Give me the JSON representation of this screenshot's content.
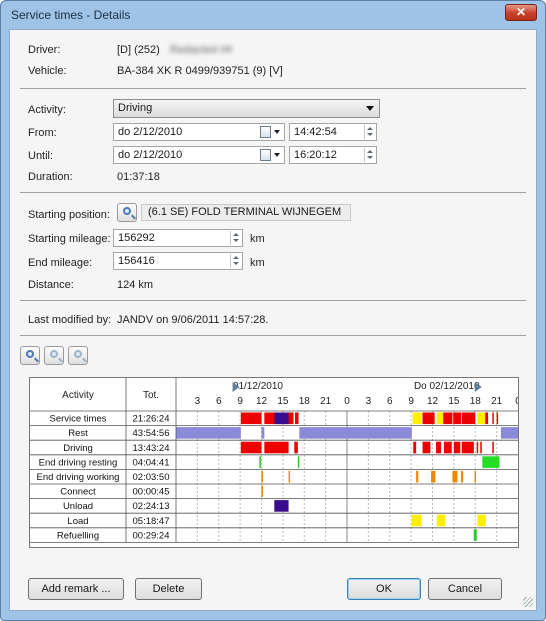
{
  "window": {
    "title": "Service times - Details",
    "close_glyph": "✕"
  },
  "info": {
    "driver_label": "Driver:",
    "driver_value": "[D] (252)",
    "driver_name_redacted": "Redacted ##",
    "vehicle_label": "Vehicle:",
    "vehicle_value": "BA-384 XK R 0499/939751 (9) [V]"
  },
  "activity": {
    "activity_label": "Activity:",
    "activity_value": "Driving",
    "from_label": "From:",
    "from_date": "do  2/12/2010",
    "from_time": "14:42:54",
    "until_label": "Until:",
    "until_date": "do  2/12/2010",
    "until_time": "16:20:12",
    "duration_label": "Duration:",
    "duration_value": "01:37:18"
  },
  "position": {
    "start_pos_label": "Starting position:",
    "start_pos_value": "(6.1 SE) FOLD TERMINAL WIJNEGEM",
    "start_mileage_label": "Starting mileage:",
    "start_mileage_value": "156292",
    "start_mileage_unit": "km",
    "end_mileage_label": "End mileage:",
    "end_mileage_value": "156416",
    "end_mileage_unit": "km",
    "distance_label": "Distance:",
    "distance_value": "124 km"
  },
  "modified": {
    "label": "Last modified by:",
    "value": "JANDV on 9/06/2011 14:57:28."
  },
  "zoom_icons": [
    "zoom-in-icon",
    "zoom-out-icon",
    "zoom-reset-icon"
  ],
  "chart_data": {
    "type": "table",
    "columns": [
      "Activity",
      "Tot."
    ],
    "day_labels": [
      "01/12/2010",
      "Do 02/12/2010"
    ],
    "hour_ticks": [
      "3",
      "6",
      "9",
      "12",
      "15",
      "18",
      "21",
      "0",
      "3",
      "6",
      "9",
      "12",
      "15",
      "18",
      "21",
      "0"
    ],
    "x_range_hours": [
      0,
      48
    ],
    "rows": [
      {
        "activity": "Service times",
        "total": "21:26:24",
        "segments": [
          {
            "s": 9.1,
            "e": 12.0,
            "c": "#ee0000"
          },
          {
            "s": 12.4,
            "e": 16.5,
            "c": "#ee0000"
          },
          {
            "s": 13.8,
            "e": 15.8,
            "c": "#3a0b8c"
          },
          {
            "s": 16.7,
            "e": 17.2,
            "c": "#ee0000"
          },
          {
            "s": 33.2,
            "e": 34.5,
            "c": "#ffee00"
          },
          {
            "s": 34.6,
            "e": 36.3,
            "c": "#ee0000"
          },
          {
            "s": 36.6,
            "e": 37.5,
            "c": "#ffee00"
          },
          {
            "s": 37.5,
            "e": 38.8,
            "c": "#ee0000"
          },
          {
            "s": 38.9,
            "e": 40.0,
            "c": "#ee0000"
          },
          {
            "s": 40.1,
            "e": 42.0,
            "c": "#ee0000"
          },
          {
            "s": 42.3,
            "e": 43.4,
            "c": "#ffee00"
          },
          {
            "s": 43.4,
            "e": 43.8,
            "c": "#ee0000"
          },
          {
            "s": 44.4,
            "e": 44.6,
            "c": "#ee0000"
          },
          {
            "s": 45.0,
            "e": 45.2,
            "c": "#ee0000"
          }
        ]
      },
      {
        "activity": "Rest",
        "total": "43:54:56",
        "segments": [
          {
            "s": 0,
            "e": 9.1,
            "c": "#8a8ad8"
          },
          {
            "s": 12.0,
            "e": 12.4,
            "c": "#8a8ad8"
          },
          {
            "s": 17.3,
            "e": 33.1,
            "c": "#8a8ad8"
          },
          {
            "s": 45.6,
            "e": 48,
            "c": "#8a8ad8"
          }
        ]
      },
      {
        "activity": "Driving",
        "total": "13:43:24",
        "segments": [
          {
            "s": 9.1,
            "e": 12.0,
            "c": "#ee0000"
          },
          {
            "s": 12.4,
            "e": 15.8,
            "c": "#ee0000"
          },
          {
            "s": 16.6,
            "e": 17.1,
            "c": "#ee0000"
          },
          {
            "s": 33.3,
            "e": 33.7,
            "c": "#ee0000"
          },
          {
            "s": 34.6,
            "e": 35.7,
            "c": "#ee0000"
          },
          {
            "s": 36.5,
            "e": 37.2,
            "c": "#ee0000"
          },
          {
            "s": 37.6,
            "e": 38.7,
            "c": "#ee0000"
          },
          {
            "s": 39.0,
            "e": 39.9,
            "c": "#ee0000"
          },
          {
            "s": 40.1,
            "e": 41.8,
            "c": "#ee0000"
          },
          {
            "s": 42.2,
            "e": 42.4,
            "c": "#ee0000"
          },
          {
            "s": 42.7,
            "e": 42.9,
            "c": "#ee0000"
          },
          {
            "s": 44.4,
            "e": 44.6,
            "c": "#ee0000"
          }
        ]
      },
      {
        "activity": "End driving resting",
        "total": "04:04:41",
        "segments": [
          {
            "s": 11.7,
            "e": 11.9,
            "c": "#22cc22"
          },
          {
            "s": 17.1,
            "e": 17.3,
            "c": "#22cc22"
          },
          {
            "s": 43.0,
            "e": 45.4,
            "c": "#22dd22"
          }
        ]
      },
      {
        "activity": "End driving working",
        "total": "02:03:50",
        "segments": [
          {
            "s": 12.0,
            "e": 12.2,
            "c": "#ee8800"
          },
          {
            "s": 15.8,
            "e": 16.0,
            "c": "#ee8800"
          },
          {
            "s": 33.7,
            "e": 34.0,
            "c": "#ee8800"
          },
          {
            "s": 35.8,
            "e": 36.4,
            "c": "#ee8800"
          },
          {
            "s": 38.8,
            "e": 39.5,
            "c": "#ee8800"
          },
          {
            "s": 40.0,
            "e": 40.3,
            "c": "#ee8800"
          },
          {
            "s": 41.9,
            "e": 42.1,
            "c": "#ee8800"
          }
        ]
      },
      {
        "activity": "Connect",
        "total": "00:00:45",
        "segments": [
          {
            "s": 12.0,
            "e": 12.15,
            "c": "#ee8800"
          }
        ]
      },
      {
        "activity": "Unload",
        "total": "02:24:13",
        "segments": [
          {
            "s": 13.8,
            "e": 15.8,
            "c": "#3a0b8c"
          }
        ]
      },
      {
        "activity": "Load",
        "total": "05:18:47",
        "segments": [
          {
            "s": 33.1,
            "e": 34.5,
            "c": "#ffee00"
          },
          {
            "s": 36.6,
            "e": 37.8,
            "c": "#ffee00"
          },
          {
            "s": 42.3,
            "e": 43.5,
            "c": "#ffee00"
          }
        ]
      },
      {
        "activity": "Refuelling",
        "total": "00:29:24",
        "segments": [
          {
            "s": 41.8,
            "e": 42.2,
            "c": "#22cc22"
          }
        ]
      }
    ]
  },
  "buttons": {
    "add_remark": "Add remark ...",
    "delete": "Delete",
    "ok": "OK",
    "cancel": "Cancel"
  }
}
